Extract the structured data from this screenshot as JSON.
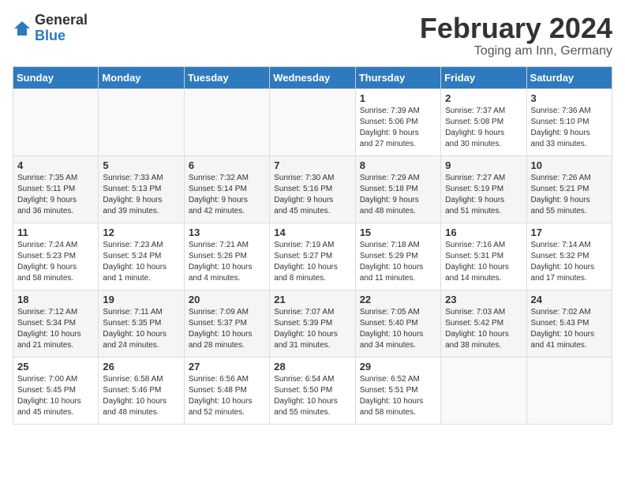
{
  "logo": {
    "general": "General",
    "blue": "Blue"
  },
  "title": "February 2024",
  "subtitle": "Toging am Inn, Germany",
  "weekdays": [
    "Sunday",
    "Monday",
    "Tuesday",
    "Wednesday",
    "Thursday",
    "Friday",
    "Saturday"
  ],
  "weeks": [
    [
      {
        "day": "",
        "info": ""
      },
      {
        "day": "",
        "info": ""
      },
      {
        "day": "",
        "info": ""
      },
      {
        "day": "",
        "info": ""
      },
      {
        "day": "1",
        "info": "Sunrise: 7:39 AM\nSunset: 5:06 PM\nDaylight: 9 hours\nand 27 minutes."
      },
      {
        "day": "2",
        "info": "Sunrise: 7:37 AM\nSunset: 5:08 PM\nDaylight: 9 hours\nand 30 minutes."
      },
      {
        "day": "3",
        "info": "Sunrise: 7:36 AM\nSunset: 5:10 PM\nDaylight: 9 hours\nand 33 minutes."
      }
    ],
    [
      {
        "day": "4",
        "info": "Sunrise: 7:35 AM\nSunset: 5:11 PM\nDaylight: 9 hours\nand 36 minutes."
      },
      {
        "day": "5",
        "info": "Sunrise: 7:33 AM\nSunset: 5:13 PM\nDaylight: 9 hours\nand 39 minutes."
      },
      {
        "day": "6",
        "info": "Sunrise: 7:32 AM\nSunset: 5:14 PM\nDaylight: 9 hours\nand 42 minutes."
      },
      {
        "day": "7",
        "info": "Sunrise: 7:30 AM\nSunset: 5:16 PM\nDaylight: 9 hours\nand 45 minutes."
      },
      {
        "day": "8",
        "info": "Sunrise: 7:29 AM\nSunset: 5:18 PM\nDaylight: 9 hours\nand 48 minutes."
      },
      {
        "day": "9",
        "info": "Sunrise: 7:27 AM\nSunset: 5:19 PM\nDaylight: 9 hours\nand 51 minutes."
      },
      {
        "day": "10",
        "info": "Sunrise: 7:26 AM\nSunset: 5:21 PM\nDaylight: 9 hours\nand 55 minutes."
      }
    ],
    [
      {
        "day": "11",
        "info": "Sunrise: 7:24 AM\nSunset: 5:23 PM\nDaylight: 9 hours\nand 58 minutes."
      },
      {
        "day": "12",
        "info": "Sunrise: 7:23 AM\nSunset: 5:24 PM\nDaylight: 10 hours\nand 1 minute."
      },
      {
        "day": "13",
        "info": "Sunrise: 7:21 AM\nSunset: 5:26 PM\nDaylight: 10 hours\nand 4 minutes."
      },
      {
        "day": "14",
        "info": "Sunrise: 7:19 AM\nSunset: 5:27 PM\nDaylight: 10 hours\nand 8 minutes."
      },
      {
        "day": "15",
        "info": "Sunrise: 7:18 AM\nSunset: 5:29 PM\nDaylight: 10 hours\nand 11 minutes."
      },
      {
        "day": "16",
        "info": "Sunrise: 7:16 AM\nSunset: 5:31 PM\nDaylight: 10 hours\nand 14 minutes."
      },
      {
        "day": "17",
        "info": "Sunrise: 7:14 AM\nSunset: 5:32 PM\nDaylight: 10 hours\nand 17 minutes."
      }
    ],
    [
      {
        "day": "18",
        "info": "Sunrise: 7:12 AM\nSunset: 5:34 PM\nDaylight: 10 hours\nand 21 minutes."
      },
      {
        "day": "19",
        "info": "Sunrise: 7:11 AM\nSunset: 5:35 PM\nDaylight: 10 hours\nand 24 minutes."
      },
      {
        "day": "20",
        "info": "Sunrise: 7:09 AM\nSunset: 5:37 PM\nDaylight: 10 hours\nand 28 minutes."
      },
      {
        "day": "21",
        "info": "Sunrise: 7:07 AM\nSunset: 5:39 PM\nDaylight: 10 hours\nand 31 minutes."
      },
      {
        "day": "22",
        "info": "Sunrise: 7:05 AM\nSunset: 5:40 PM\nDaylight: 10 hours\nand 34 minutes."
      },
      {
        "day": "23",
        "info": "Sunrise: 7:03 AM\nSunset: 5:42 PM\nDaylight: 10 hours\nand 38 minutes."
      },
      {
        "day": "24",
        "info": "Sunrise: 7:02 AM\nSunset: 5:43 PM\nDaylight: 10 hours\nand 41 minutes."
      }
    ],
    [
      {
        "day": "25",
        "info": "Sunrise: 7:00 AM\nSunset: 5:45 PM\nDaylight: 10 hours\nand 45 minutes."
      },
      {
        "day": "26",
        "info": "Sunrise: 6:58 AM\nSunset: 5:46 PM\nDaylight: 10 hours\nand 48 minutes."
      },
      {
        "day": "27",
        "info": "Sunrise: 6:56 AM\nSunset: 5:48 PM\nDaylight: 10 hours\nand 52 minutes."
      },
      {
        "day": "28",
        "info": "Sunrise: 6:54 AM\nSunset: 5:50 PM\nDaylight: 10 hours\nand 55 minutes."
      },
      {
        "day": "29",
        "info": "Sunrise: 6:52 AM\nSunset: 5:51 PM\nDaylight: 10 hours\nand 58 minutes."
      },
      {
        "day": "",
        "info": ""
      },
      {
        "day": "",
        "info": ""
      }
    ]
  ]
}
